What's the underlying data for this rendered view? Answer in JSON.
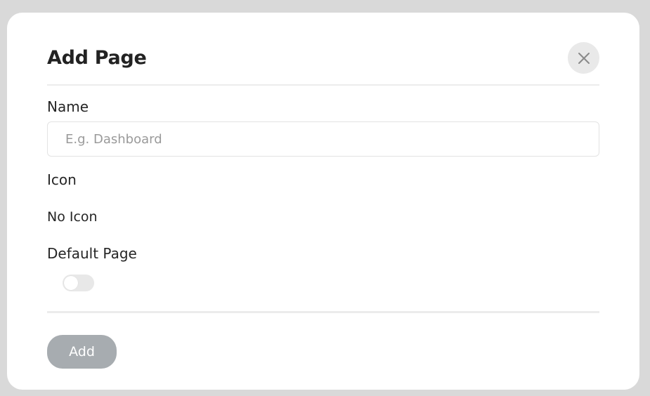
{
  "dialog": {
    "title": "Add Page",
    "close_icon": "close-icon"
  },
  "form": {
    "name": {
      "label": "Name",
      "value": "",
      "placeholder": "E.g. Dashboard"
    },
    "icon": {
      "label": "Icon",
      "value": "No Icon"
    },
    "default_page": {
      "label": "Default Page",
      "enabled": false
    }
  },
  "actions": {
    "add_label": "Add"
  },
  "colors": {
    "backdrop": "#d9d9d9",
    "dialog_bg": "#ffffff",
    "close_button_bg": "#e9e9e9",
    "add_button_bg": "#a7acb0",
    "toggle_off_bg": "#e8e8e8"
  }
}
